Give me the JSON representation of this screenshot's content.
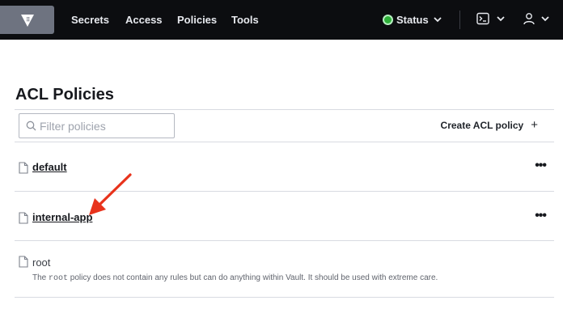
{
  "nav": {
    "links": [
      "Secrets",
      "Access",
      "Policies",
      "Tools"
    ],
    "status_label": "Status"
  },
  "page": {
    "title": "ACL Policies"
  },
  "toolbar": {
    "filter_placeholder": "Filter policies",
    "create_label": "Create ACL policy"
  },
  "policies": [
    {
      "name": "default",
      "more_icon": "•••"
    },
    {
      "name": "internal-app",
      "more_icon": "•••"
    },
    {
      "name": "root"
    }
  ],
  "root_description": {
    "prefix": "The ",
    "code": "root",
    "suffix": " policy does not contain any rules but can do anything within Vault. It should be used with extreme care."
  },
  "colors": {
    "topbar": "#0c0d10",
    "status_green": "#2eb039",
    "annotation_arrow": "#e8331c"
  }
}
